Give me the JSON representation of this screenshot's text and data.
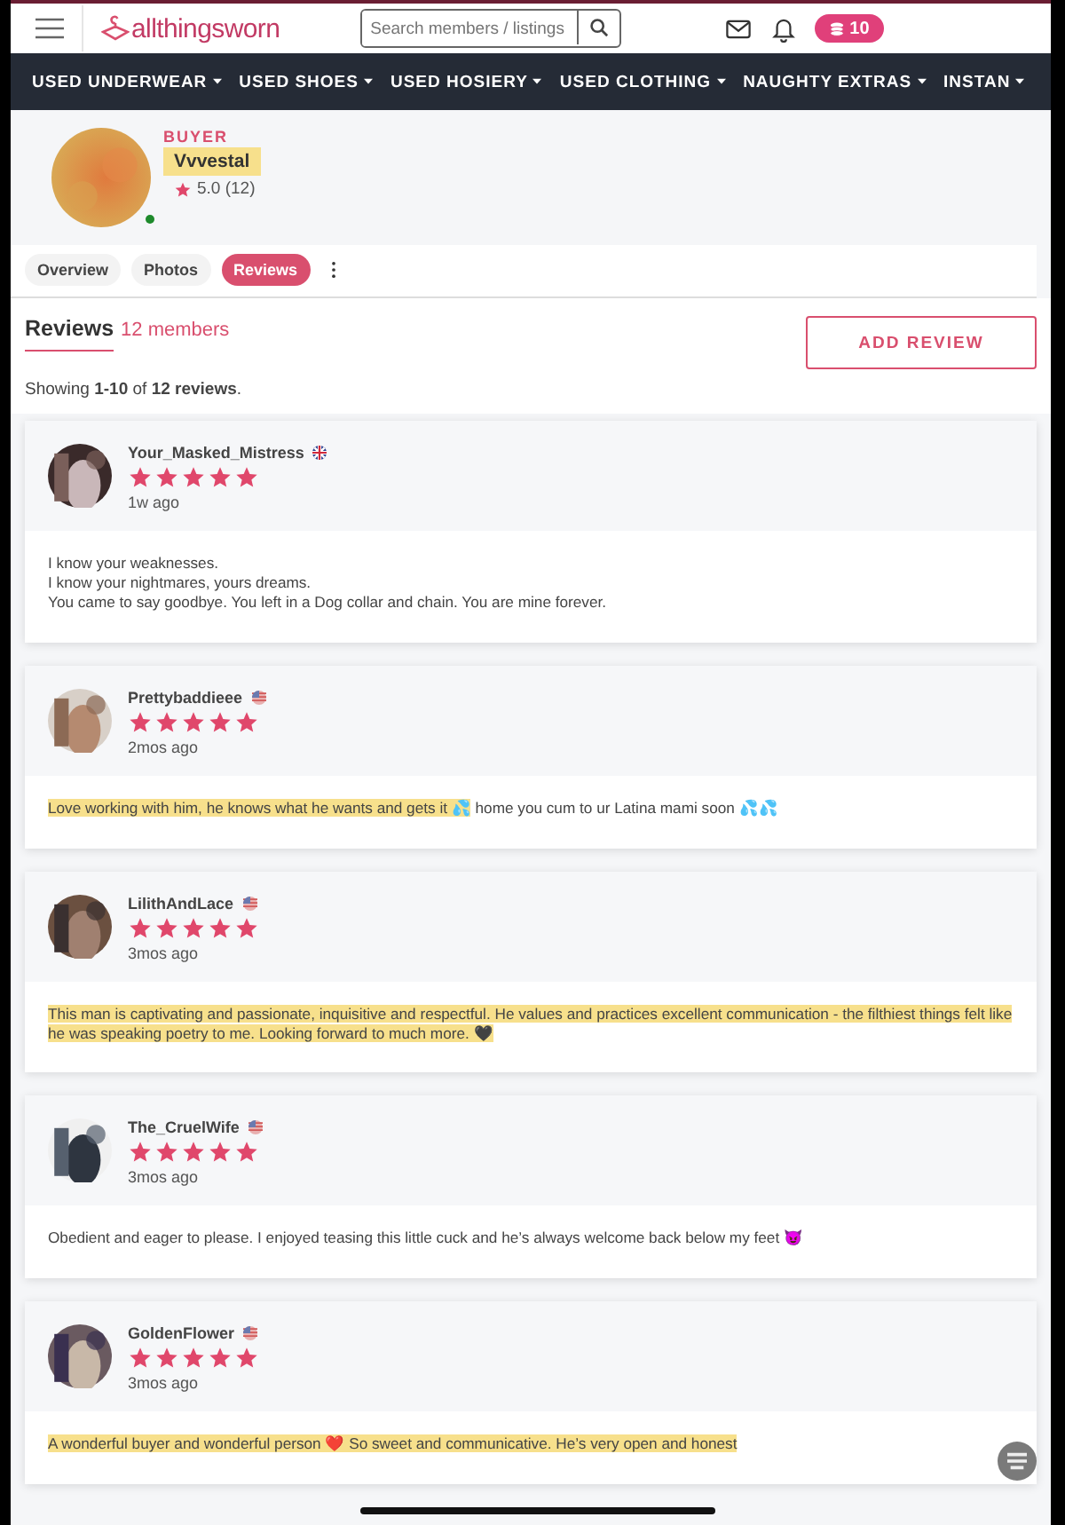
{
  "header": {
    "logo": "allthingsworn",
    "search": {
      "placeholder": "Search members / listings"
    },
    "tokens": "10"
  },
  "nav": [
    "USED UNDERWEAR",
    "USED SHOES",
    "USED HOSIERY",
    "USED CLOTHING",
    "NAUGHTY EXTRAS",
    "INSTAN"
  ],
  "profile": {
    "role": "BUYER",
    "name": "Vvvestal",
    "name_highlighted": true,
    "rating": "5.0 (12)",
    "online": true
  },
  "tabs": [
    {
      "label": "Overview",
      "selected": false
    },
    {
      "label": "Photos",
      "selected": false
    },
    {
      "label": "Reviews",
      "selected": true
    }
  ],
  "reviews_heading": {
    "title": "Reviews",
    "count": "12 members",
    "button": "ADD REVIEW"
  },
  "showing": "Showing **1-10** of **12 reviews**.",
  "reviews": [
    {
      "user": "Your_Masked_Mistress",
      "flag": {
        "kind": "uk"
      },
      "stars": 5,
      "time": "1w ago",
      "body": [
        {
          "text": "I know your weaknesses.\nI know your nightmares, yours dreams.\nYou came to say goodbye. You left in a Dog collar and chain. You are mine forever.",
          "highlighted": false
        }
      ]
    },
    {
      "user": "Prettybaddieee",
      "flag": {
        "kind": "us"
      },
      "stars": 5,
      "time": "2mos ago",
      "body": [
        {
          "text": "Love working with him, he knows what he wants and gets it 💦",
          "highlighted": true
        },
        {
          "text": " home you cum to ur Latina mami soon 💦💦",
          "highlighted": false
        }
      ]
    },
    {
      "user": "LilithAndLace",
      "flag": {
        "kind": "us"
      },
      "stars": 5,
      "time": "3mos ago",
      "body": [
        {
          "text": "This man is captivating and passionate, inquisitive and respectful. He values and practices excellent communication - the filthiest things felt like he was speaking poetry to me. Looking forward to much more. 🖤",
          "highlighted": true
        }
      ]
    },
    {
      "user": "The_CruelWife",
      "flag": {
        "kind": "us"
      },
      "stars": 5,
      "time": "3mos ago",
      "body": [
        {
          "text": "Obedient and eager to please. I enjoyed teasing this little cuck and he’s always welcome back below my feet 😈",
          "highlighted": false
        }
      ]
    },
    {
      "user": "GoldenFlower",
      "flag": {
        "kind": "us"
      },
      "stars": 5,
      "time": "3mos ago",
      "body": [
        {
          "text": "A wonderful buyer and wonderful person ❤️ So sweet and communicative. He’s very open and honest",
          "highlighted": true
        }
      ]
    }
  ]
}
